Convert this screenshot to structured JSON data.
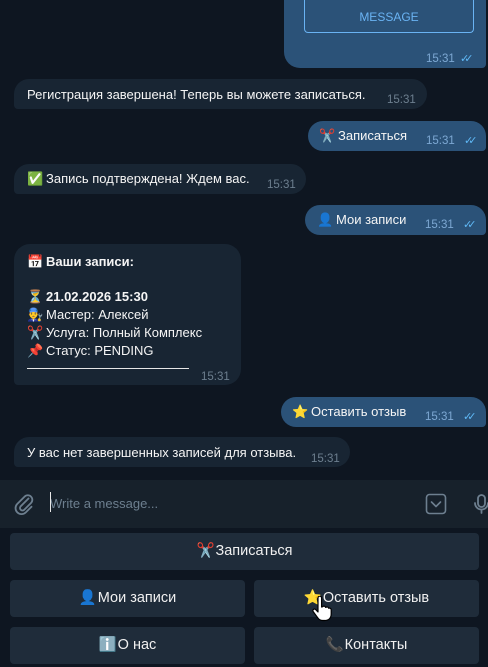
{
  "messages": {
    "m0": {
      "button": "MESSAGE",
      "time": "15:31"
    },
    "m1": {
      "text": "Регистрация завершена! Теперь вы можете записаться.",
      "time": "15:31"
    },
    "m2": {
      "emoji": "✂️",
      "text": "Записаться",
      "time": "15:31"
    },
    "m3": {
      "emoji": "✅",
      "text": "Запись подтверждена! Ждем вас.",
      "time": "15:31"
    },
    "m4": {
      "emoji": "👤",
      "text": "Мои записи",
      "time": "15:31"
    },
    "m5": {
      "header_emoji": "📅",
      "header": "Ваши записи:",
      "date_emoji": "⏳",
      "date": "21.02.2026 15:30",
      "master_emoji": "👨‍🔧",
      "master": "Мастер: Алексей",
      "service_emoji": "✂️",
      "service": "Услуга: Полный Комплекс",
      "status_emoji": "📌",
      "status": "Статус: PENDING",
      "time": "15:31"
    },
    "m6": {
      "emoji": "⭐",
      "text": "Оставить отзыв",
      "time": "15:31"
    },
    "m7": {
      "text": "У вас нет завершенных записей для отзыва.",
      "time": "15:31"
    }
  },
  "input": {
    "placeholder": "Write a message..."
  },
  "keyboard": {
    "btn_book": {
      "emoji": "✂️",
      "label": "Записаться"
    },
    "btn_my": {
      "emoji": "👤",
      "label": "Мои записи"
    },
    "btn_review": {
      "emoji": "⭐",
      "label": "Оставить отзыв"
    },
    "btn_about": {
      "emoji": "ℹ️",
      "label": "О нас"
    },
    "btn_contacts": {
      "emoji": "📞",
      "label": "Контакты"
    }
  },
  "colors": {
    "background": "#0e1621",
    "incoming_bubble": "#182533",
    "outgoing_bubble": "#2b5278",
    "accent": "#6ab3f3",
    "read_ticks": "#5fb8f5"
  }
}
